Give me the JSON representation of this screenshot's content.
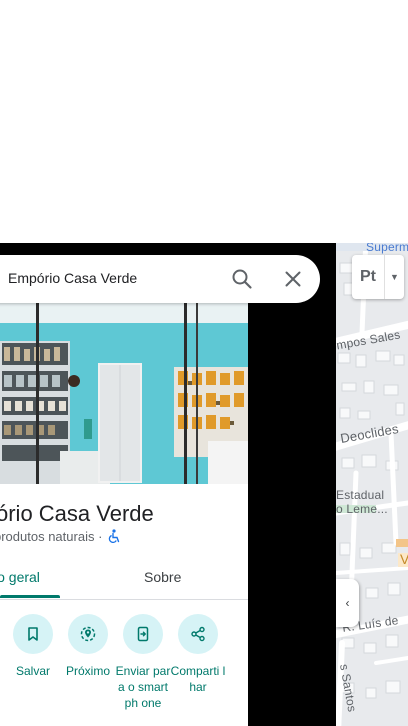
{
  "search": {
    "query": "Empório Casa Verde"
  },
  "place": {
    "title": "ório Casa Verde",
    "subtitle": "produtos naturais ·"
  },
  "tabs": [
    {
      "label": "io geral",
      "active": true
    },
    {
      "label": "Sobre",
      "active": false
    }
  ],
  "actions": [
    {
      "label": "Salvar",
      "icon": "bookmark-icon"
    },
    {
      "label": "Próximo",
      "icon": "nearby-icon"
    },
    {
      "label": "Enviar para o smartph one",
      "icon": "send-to-phone-icon"
    },
    {
      "label": "Comparti lhar",
      "icon": "share-icon"
    }
  ],
  "map": {
    "labels": [
      "Superm",
      "mpos Sales",
      "Deoclides",
      "Estadual",
      "o Leme...",
      "V",
      "R. Luís de",
      "s Santos"
    ],
    "layer_button": "Pt",
    "collapse_glyph": "‹"
  },
  "colors": {
    "accent": "#00796b",
    "action_circle": "#d6f3f6",
    "map_bg": "#e9ebee"
  }
}
